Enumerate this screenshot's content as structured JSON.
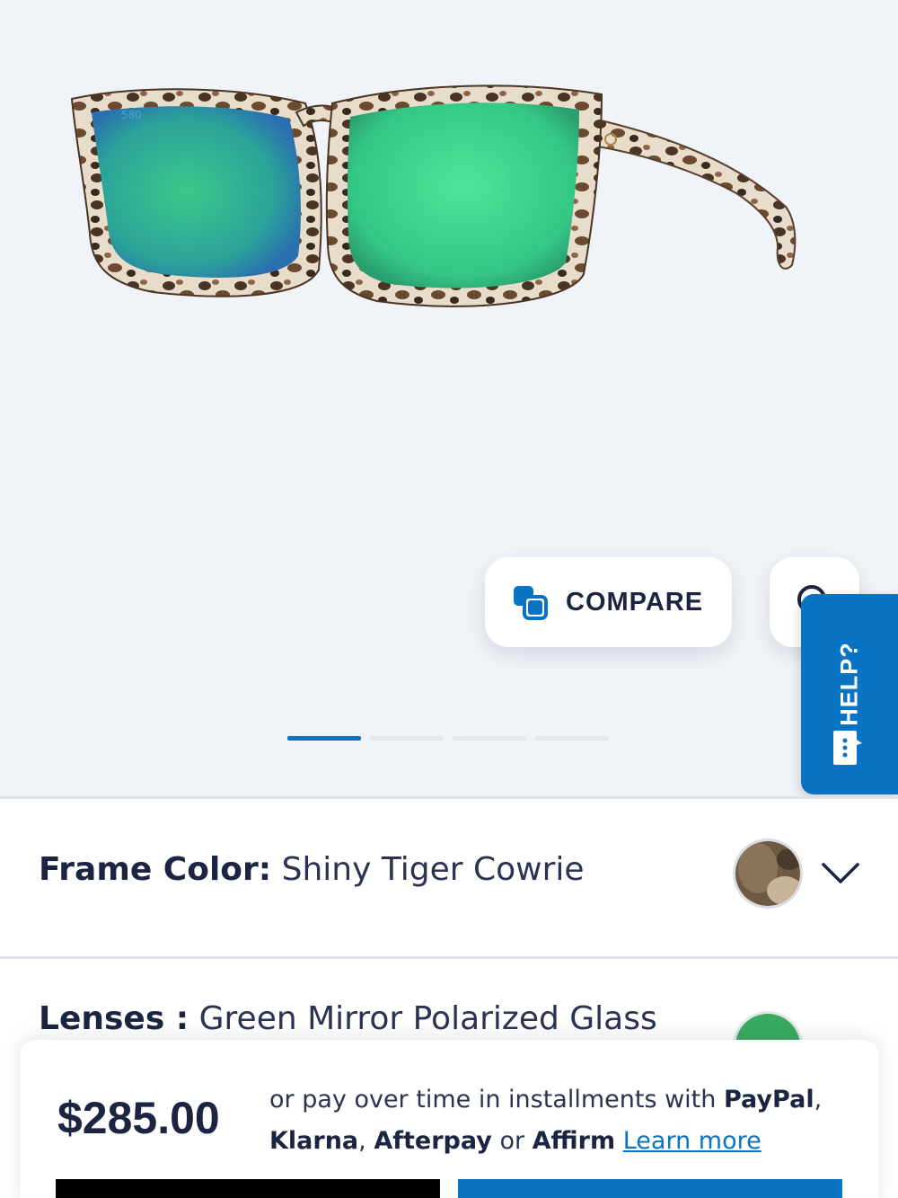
{
  "gallery": {
    "image_alt": "Sunglasses with tortoise frame and green mirror lenses",
    "lens_mark": "580",
    "slides_total": 4,
    "active_slide_index": 0
  },
  "compare": {
    "label": "COMPARE"
  },
  "help": {
    "label": "HELP?"
  },
  "options": {
    "frame_color": {
      "label": "Frame Color:",
      "value": "Shiny Tiger Cowrie"
    },
    "lenses": {
      "label": "Lenses :",
      "value": "Green Mirror Polarized Glass"
    }
  },
  "purchase": {
    "price": "$285.00",
    "pay_prefix": "or pay over time in installments with",
    "paypal": "PayPal",
    "comma1": ",",
    "klarna": "Klarna",
    "comma2": ",",
    "afterpay": "Afterpay",
    "or_word": "or",
    "affirm": "Affirm",
    "learn_more": "Learn more"
  },
  "colors": {
    "brand_blue": "#0a74c4",
    "text_dark": "#1b2440",
    "lens_green": "#3dd68c"
  }
}
